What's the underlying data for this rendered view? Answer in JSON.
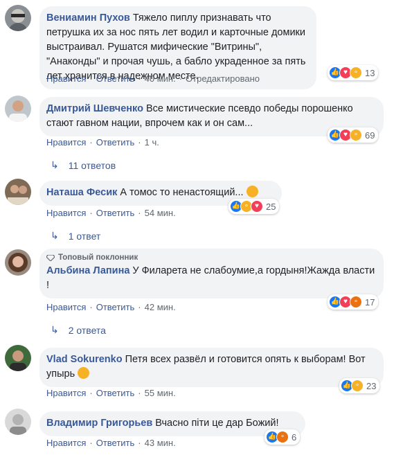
{
  "colors": {
    "link": "#385898",
    "meta": "#606770",
    "bubble": "#f2f3f5",
    "like": "#1877f2",
    "love": "#f33e58",
    "haha": "#f7b125",
    "angry": "#e9710f"
  },
  "comments": [
    {
      "author": "Вениамин Пухов",
      "text": "Тяжело пиплу признавать что петрушка их за нос пять лет водил и карточные домики выстраивал. Рушатся мифические \"Витрины\", \"Анаконды\" и прочая чушь, а бабло украденное за пять лет хранится в надежном месте.",
      "like": "Нравится",
      "reply": "Ответить",
      "time": "40 мин.",
      "edited": "Отредактировано",
      "reactions": [
        "like",
        "love",
        "haha"
      ],
      "count": "13"
    },
    {
      "author": "Дмитрий Шевченко",
      "text": "Все мистические псевдо победы порошенко стают гавном нации, впрочем как и он сам...",
      "like": "Нравится",
      "reply": "Ответить",
      "time": "1 ч.",
      "reactions": [
        "like",
        "love",
        "haha"
      ],
      "count": "69",
      "replies": "11 ответов"
    },
    {
      "author": "Наташа Фесик",
      "text": "А томос то ненастоящий...",
      "like": "Нравится",
      "reply": "Ответить",
      "time": "54 мин.",
      "reactions": [
        "like",
        "haha",
        "love"
      ],
      "count": "25",
      "replies": "1 ответ"
    },
    {
      "badge": "Топовый поклонник",
      "author": "Альбина Лапина",
      "text": "У Филарета не слабоумие,а гордыня!Жажда власти !",
      "like": "Нравится",
      "reply": "Ответить",
      "time": "42 мин.",
      "reactions": [
        "like",
        "love",
        "angry"
      ],
      "count": "17",
      "replies": "2 ответа"
    },
    {
      "author": "Vlad Sokurenko",
      "text": "Петя всех развёл и готовится опять к выборам! Вот упырь",
      "like": "Нравится",
      "reply": "Ответить",
      "time": "55 мин.",
      "reactions": [
        "like",
        "sad"
      ],
      "count": "23"
    },
    {
      "author": "Владимир Григорьев",
      "text": "Вчасно піти це дар Божий!",
      "like": "Нравится",
      "reply": "Ответить",
      "time": "43 мин.",
      "reactions": [
        "like",
        "angry"
      ],
      "count": "6"
    }
  ]
}
